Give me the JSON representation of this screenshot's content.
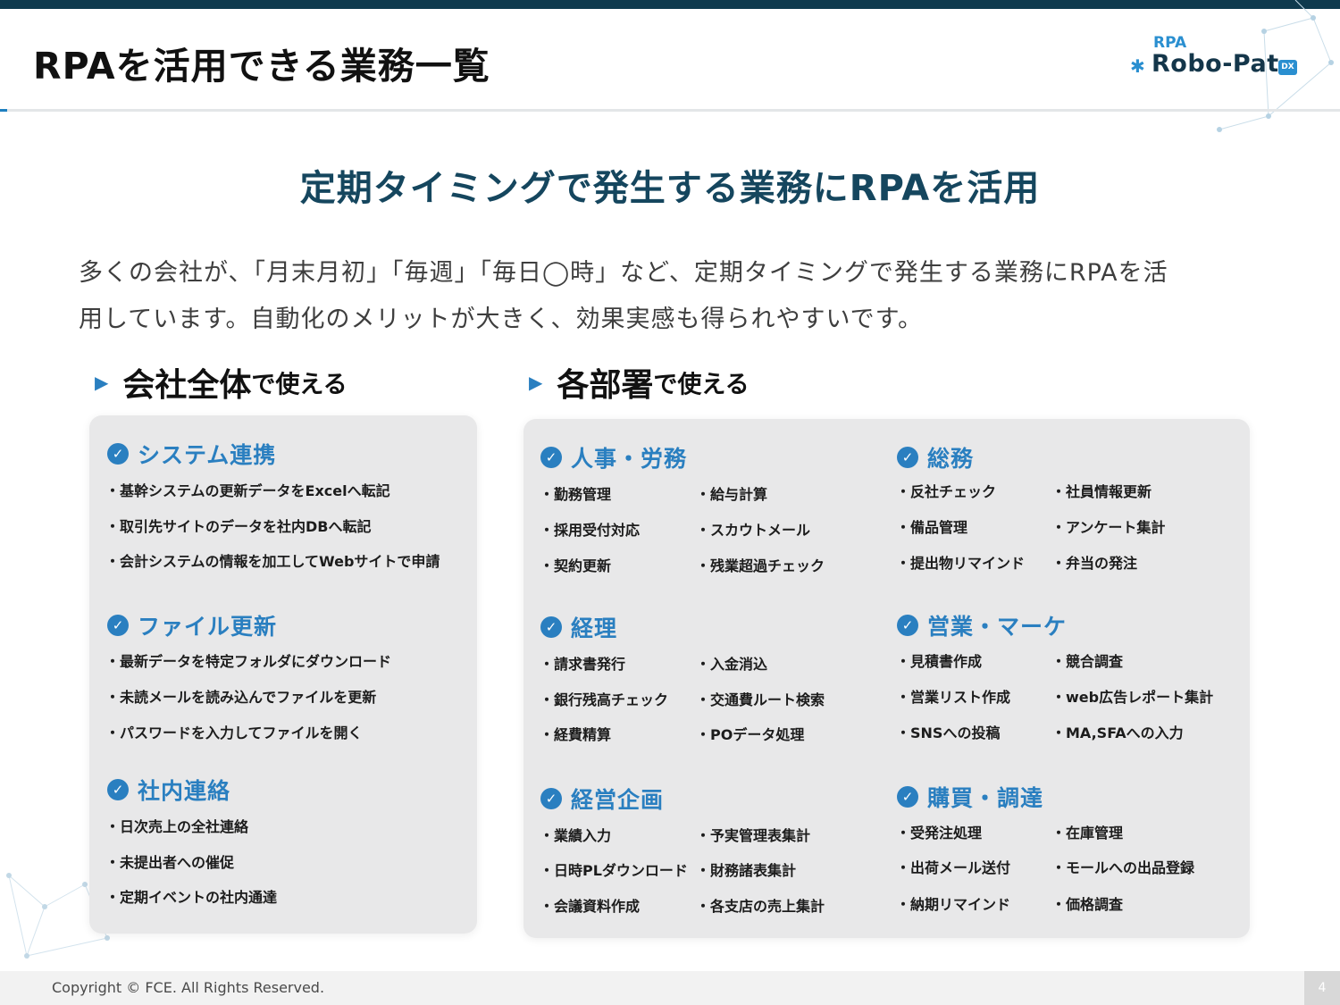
{
  "title": "RPAを活用できる業務一覧",
  "logo": {
    "small": "RPA",
    "name": "Robo-Pat",
    "badge": "DX"
  },
  "subtitle": "定期タイミングで発生する業務にRPAを活用",
  "intro": {
    "line1": "多くの会社が、「月末月初」「毎週」「毎日◯時」など、定期タイミングで発生する業務にRPAを活",
    "line2": "用しています。自動化のメリットが大きく、効果実感も得られやすいです。"
  },
  "sections": {
    "company": {
      "big": "会社全体",
      "small": "で使える"
    },
    "dept": {
      "big": "各部署",
      "small": "で使える"
    }
  },
  "company_categories": [
    {
      "title": "システム連携",
      "items": [
        "・基幹システムの更新データをExcelへ転記",
        "・取引先サイトのデータを社内DBへ転記",
        "・会計システムの情報を加工してWebサイトで申請"
      ]
    },
    {
      "title": "ファイル更新",
      "items": [
        "・最新データを特定フォルダにダウンロード",
        "・未読メールを読み込んでファイルを更新",
        "・パスワードを入力してファイルを開く"
      ]
    },
    {
      "title": "社内連絡",
      "items": [
        "・日次売上の全社連絡",
        "・未提出者への催促",
        "・定期イベントの社内通達"
      ]
    }
  ],
  "dept_categories": [
    {
      "title": "人事・労務",
      "items": [
        "・勤務管理",
        "・給与計算",
        "・採用受付対応",
        "・スカウトメール",
        "・契約更新",
        "・残業超過チェック"
      ]
    },
    {
      "title": "総務",
      "items": [
        "・反社チェック",
        "・社員情報更新",
        "・備品管理",
        "・アンケート集計",
        "・提出物リマインド",
        "・弁当の発注"
      ]
    },
    {
      "title": "経理",
      "items": [
        "・請求書発行",
        "・入金消込",
        "・銀行残高チェック",
        "・交通費ルート検索",
        "・経費精算",
        "・POデータ処理"
      ]
    },
    {
      "title": "営業・マーケ",
      "items": [
        "・見積書作成",
        "・競合調査",
        "・営業リスト作成",
        "・web広告レポート集計",
        "・SNSへの投稿",
        "・MA,SFAへの入力"
      ]
    },
    {
      "title": "経営企画",
      "items": [
        "・業績入力",
        "・予実管理表集計",
        "・日時PLダウンロード",
        "・財務諸表集計",
        "・会議資料作成",
        "・各支店の売上集計"
      ]
    },
    {
      "title": "購買・調達",
      "items": [
        "・受発注処理",
        "・在庫管理",
        "・出荷メール送付",
        "・モールへの出品登録",
        "・納期リマインド",
        "・価格調査"
      ]
    }
  ],
  "footer": {
    "copyright": "Copyright © FCE. All Rights Reserved.",
    "page": "4"
  }
}
